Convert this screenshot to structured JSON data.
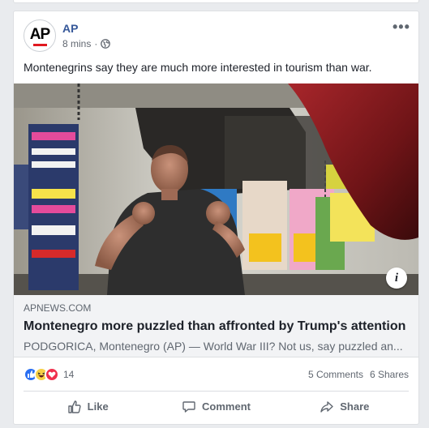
{
  "post": {
    "author": "AP",
    "avatar_text": "AP",
    "time": "8 mins",
    "separator": "·",
    "privacy_icon": "globe-icon",
    "more_label": "•••",
    "caption": "Montenegrins say they are much more interested in tourism than war."
  },
  "link": {
    "domain": "APNEWS.COM",
    "title": "Montenegro more puzzled than affronted by Trump's attention",
    "description": "PODGORICA, Montenegro (AP) — World War III? Not us, say puzzled an...",
    "info_label": "i"
  },
  "image": {
    "description_icon": "boxer-training-photo"
  },
  "stats": {
    "reaction_count": "14",
    "comments": "5 Comments",
    "shares": "6 Shares",
    "reaction_types": [
      "like",
      "haha",
      "love"
    ]
  },
  "actions": {
    "like": "Like",
    "comment": "Comment",
    "share": "Share"
  },
  "colors": {
    "author_blue": "#365899",
    "like_blue": "#2a6ff2",
    "haha_yellow": "#f7d046",
    "love_red": "#f0304d",
    "ap_red": "#e0191f"
  }
}
